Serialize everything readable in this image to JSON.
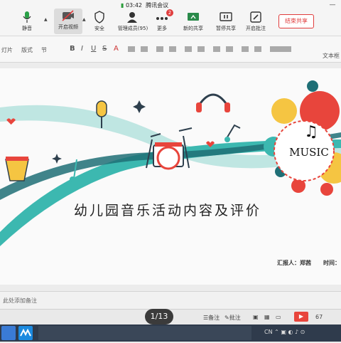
{
  "meeting": {
    "app_title": "腾讯会议",
    "time": "03:42",
    "toolbar": [
      {
        "label": "静音",
        "icon": "microphone-icon"
      },
      {
        "label": "开启视频",
        "icon": "camera-off-icon"
      },
      {
        "label": "安全",
        "icon": "shield-icon"
      },
      {
        "label": "管理成员(95)",
        "icon": "members-icon"
      },
      {
        "label": "更多",
        "icon": "more-icon",
        "badge": "2"
      },
      {
        "label": "新的共享",
        "icon": "share-screen-icon"
      },
      {
        "label": "暂停共享",
        "icon": "pause-share-icon"
      },
      {
        "label": "开启批注",
        "icon": "annotate-icon"
      }
    ],
    "end_share_label": "结束共享",
    "minimize_label": "—"
  },
  "ribbon": {
    "row1": [
      "灯片",
      "版式",
      "节"
    ],
    "format_buttons": [
      "B",
      "I",
      "U",
      "S",
      "A"
    ],
    "right_label": "文本框"
  },
  "slide": {
    "title": "幼儿园音乐活动内容及评价",
    "music_label": "MUSIC",
    "reporter_label": "汇报人：郑茜",
    "time_label": "时间："
  },
  "notes": {
    "placeholder": "此处添加备注"
  },
  "statusbar": {
    "page_indicator": "1/13",
    "notes_label": "备注",
    "comment_label": "批注",
    "zoom": "67"
  },
  "colors": {
    "teal": "#3cb8b0",
    "red": "#e8453c",
    "dark_teal": "#1f6f76",
    "yellow": "#f5c542",
    "end_share_red": "#e03c3c"
  }
}
